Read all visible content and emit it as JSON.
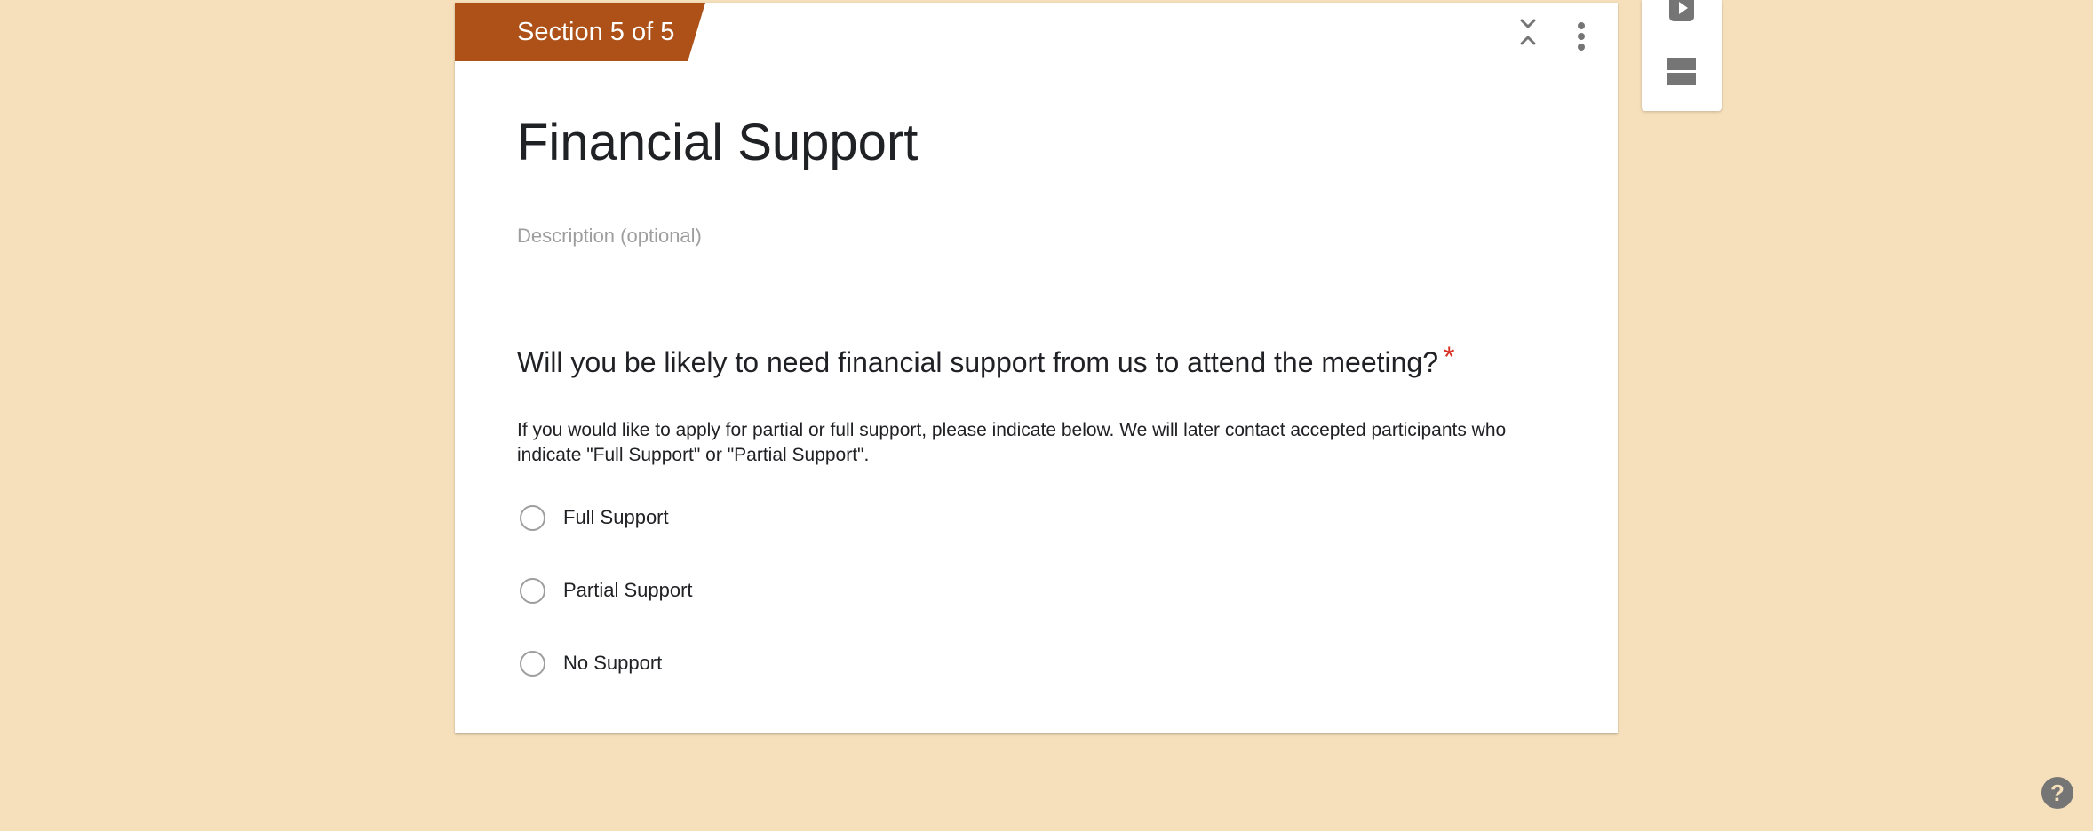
{
  "section": {
    "tab_label": "Section 5 of 5",
    "title": "Financial Support",
    "description_placeholder": "Description (optional)"
  },
  "question": {
    "title": "Will you be likely to need financial support from us to attend the meeting?",
    "required_marker": "*",
    "help_text": "If you would like to apply for partial or full support, please indicate below. We will later contact accepted participants who indicate \"Full Support\" or \"Partial Support\".",
    "options": [
      {
        "label": "Full Support"
      },
      {
        "label": "Partial Support"
      },
      {
        "label": "No Support"
      }
    ]
  },
  "icons": {
    "collapse": "collapse-icon",
    "more": "more-vert-icon",
    "video": "video-icon",
    "section": "add-section-icon",
    "help": "help-icon"
  },
  "help": {
    "label": "?"
  },
  "colors": {
    "background": "#f6dfbb",
    "section_tab": "#ad5118",
    "required": "#d93025",
    "icon": "#757575"
  }
}
